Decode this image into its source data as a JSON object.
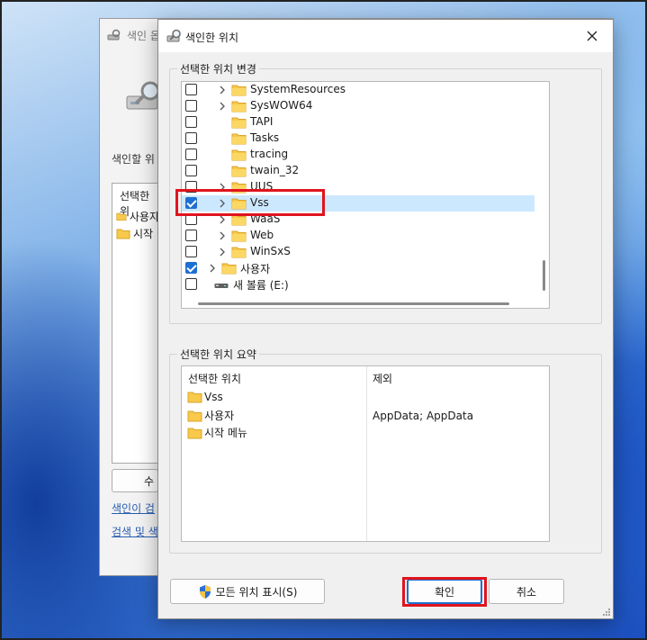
{
  "background_window": {
    "title": "색인 옵",
    "label": "색인할 위",
    "list_header": "선택한 위",
    "list_items": [
      "사용자",
      "시작"
    ],
    "button_partial": "수",
    "links": [
      "색인이 검",
      "검색 및 색"
    ]
  },
  "dialog": {
    "title": "색인한 위치",
    "change_group_label": "선택한 위치 변경",
    "tree": [
      {
        "label": "SystemResources",
        "checked": false,
        "expander": true,
        "indent": 1,
        "selected": false
      },
      {
        "label": "SysWOW64",
        "checked": false,
        "expander": true,
        "indent": 1,
        "selected": false
      },
      {
        "label": "TAPI",
        "checked": false,
        "expander": false,
        "indent": 1,
        "selected": false
      },
      {
        "label": "Tasks",
        "checked": false,
        "expander": false,
        "indent": 1,
        "selected": false
      },
      {
        "label": "tracing",
        "checked": false,
        "expander": false,
        "indent": 1,
        "selected": false
      },
      {
        "label": "twain_32",
        "checked": false,
        "expander": false,
        "indent": 1,
        "selected": false
      },
      {
        "label": "UUS",
        "checked": false,
        "expander": true,
        "indent": 1,
        "selected": false
      },
      {
        "label": "Vss",
        "checked": true,
        "expander": true,
        "indent": 1,
        "selected": true
      },
      {
        "label": "WaaS",
        "checked": false,
        "expander": true,
        "indent": 1,
        "selected": false
      },
      {
        "label": "Web",
        "checked": false,
        "expander": true,
        "indent": 1,
        "selected": false
      },
      {
        "label": "WinSxS",
        "checked": false,
        "expander": true,
        "indent": 1,
        "selected": false
      },
      {
        "label": "사용자",
        "checked": true,
        "expander": true,
        "indent": 0,
        "selected": false
      },
      {
        "label": "새 볼륨 (E:)",
        "checked": false,
        "expander": false,
        "indent": 0,
        "selected": false,
        "drive": true
      }
    ],
    "summary_group_label": "선택한 위치 요약",
    "summary_headers": {
      "location": "선택한 위치",
      "exclude": "제외"
    },
    "summary_rows": [
      {
        "location": "Vss",
        "exclude": ""
      },
      {
        "location": "사용자",
        "exclude": "AppData; AppData"
      },
      {
        "location": "시작 메뉴",
        "exclude": ""
      }
    ],
    "buttons": {
      "show_all": "모든 위치 표시(S)",
      "ok": "확인",
      "cancel": "취소"
    }
  },
  "colors": {
    "highlight": "#e0141e",
    "selection": "#cce8ff",
    "checkbox_accent": "#1f6fd1",
    "folder": "#f8c94a"
  }
}
